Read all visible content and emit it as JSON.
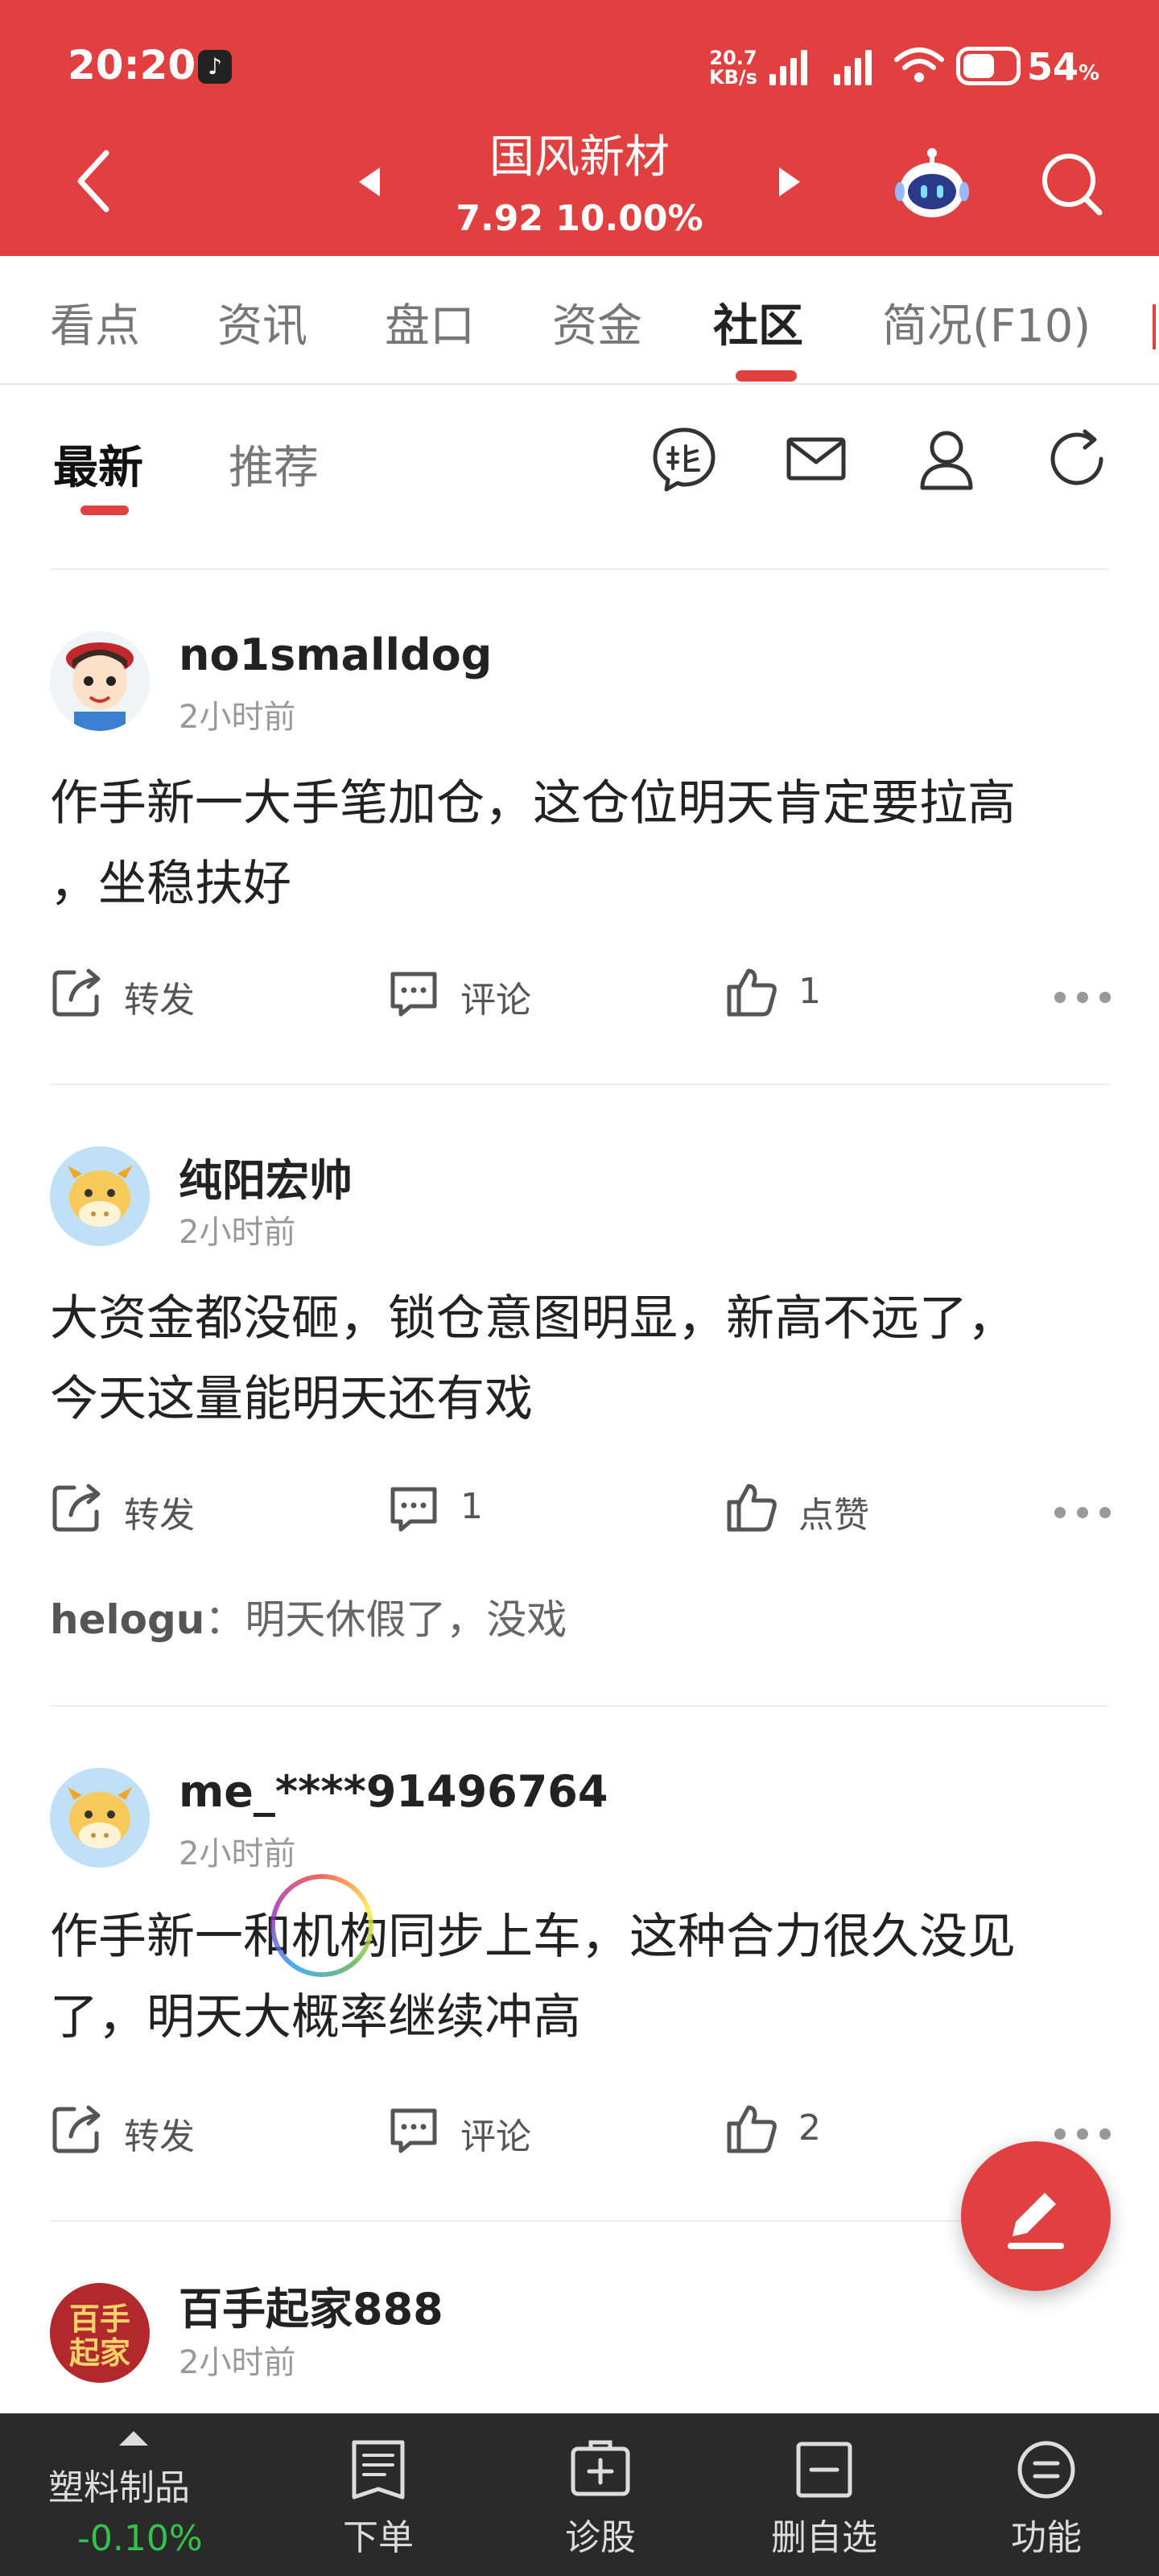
{
  "status_bar": {
    "time": "20:20",
    "net_speed_value": "20.7",
    "net_speed_unit": "KB/s",
    "battery": "54",
    "battery_unit": "%"
  },
  "header": {
    "stock_name": "国风新材",
    "stock_price_change": "7.92 10.00%"
  },
  "tabs": [
    {
      "label": "看点"
    },
    {
      "label": "资讯"
    },
    {
      "label": "盘口"
    },
    {
      "label": "资金"
    },
    {
      "label": "社区"
    },
    {
      "label": "简况(F10)"
    }
  ],
  "active_tab": "社区",
  "subtabs": [
    {
      "label": "最新"
    },
    {
      "label": "推荐"
    }
  ],
  "posts": [
    {
      "username": "no1smalldog",
      "time": "2小时前",
      "content_line1": "作手新一大手笔加仓，这仓位明天肯定要拉高",
      "content_line2": "，坐稳扶好",
      "repost_label": "转发",
      "comment_label": "评论",
      "like_label": "1"
    },
    {
      "username": "纯阳宏帅",
      "time": "2小时前",
      "content_line1": "大资金都没砸，锁仓意图明显，新高不远了，",
      "content_line2": "今天这量能明天还有戏",
      "repost_label": "转发",
      "comment_label": "1",
      "like_label": "点赞",
      "reply_user": "helogu",
      "reply_sep": "：",
      "reply_text": "明天休假了，没戏"
    },
    {
      "username": "me_****91496764",
      "time": "2小时前",
      "content_line1": "作手新一和机构同步上车，这种合力很久没见",
      "content_line2": "了，明天大概率继续冲高",
      "repost_label": "转发",
      "comment_label": "评论",
      "like_label": "2"
    },
    {
      "username": "百手起家888",
      "time": "2小时前",
      "avatar_text": "百手起家"
    }
  ],
  "bottom_nav": {
    "stock_name": "塑料制品",
    "stock_change": "-0.10%",
    "items": [
      {
        "label": "下单"
      },
      {
        "label": "诊股"
      },
      {
        "label": "删自选"
      },
      {
        "label": "功能"
      }
    ]
  },
  "colors": {
    "brand_red": "#e04040",
    "fall_green": "#34c24a",
    "bottom_bar": "#2a2a2a"
  },
  "icons": [
    "tiktok-icon",
    "signal-icon",
    "wifi-icon",
    "battery-icon",
    "back-arrow-icon",
    "prev-arrow-icon",
    "next-arrow-icon",
    "robot-icon",
    "search-icon",
    "stock-bar-icon",
    "mail-icon",
    "user-icon",
    "refresh-icon",
    "repost-icon",
    "comment-icon",
    "like-icon",
    "more-icon",
    "edit-icon",
    "order-icon",
    "diagnose-icon",
    "remove-watchlist-icon",
    "menu-icon"
  ]
}
